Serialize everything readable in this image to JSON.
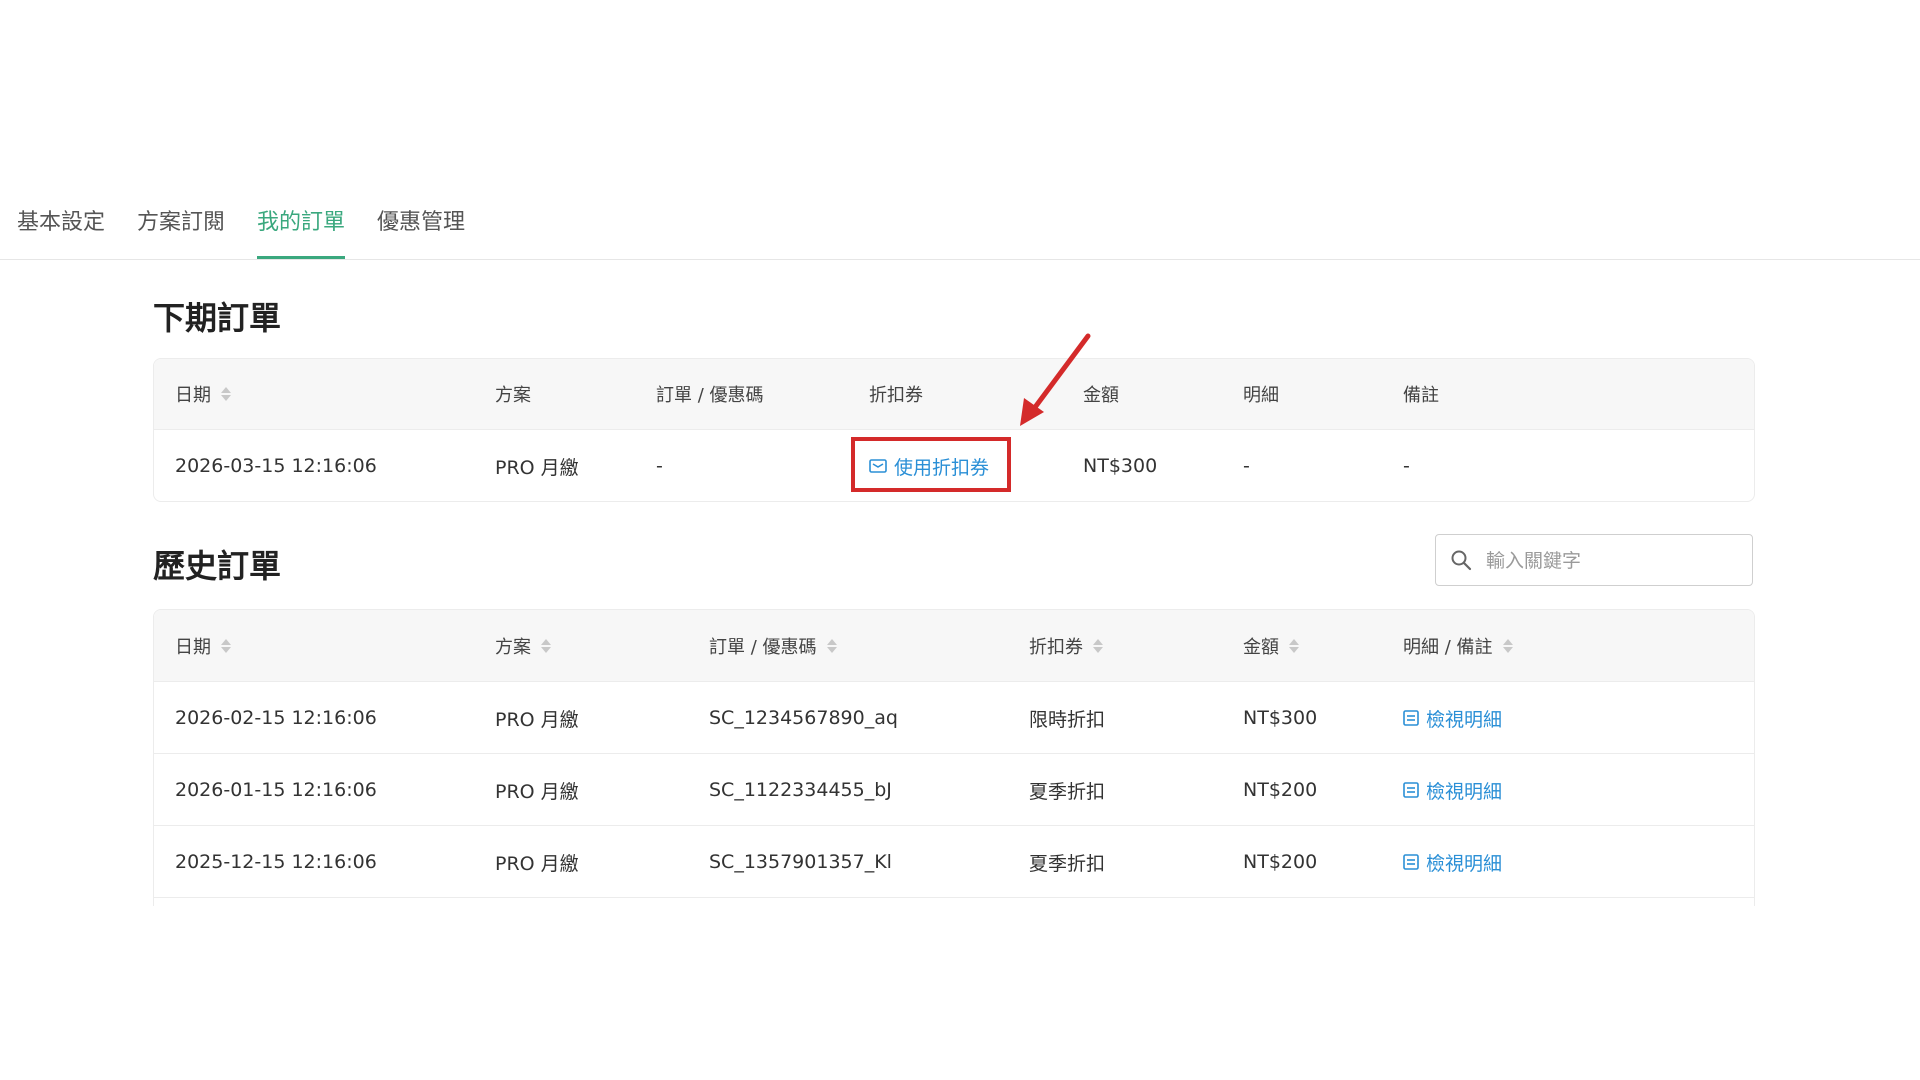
{
  "tabs": [
    {
      "label": "基本設定",
      "active": false
    },
    {
      "label": "方案訂閱",
      "active": false
    },
    {
      "label": "我的訂單",
      "active": true
    },
    {
      "label": "優惠管理",
      "active": false
    }
  ],
  "colors": {
    "accent": "#3aa87e",
    "link": "#2a8fd6",
    "highlight": "#d42a2a"
  },
  "upcoming": {
    "title": "下期訂單",
    "headers": [
      "日期",
      "方案",
      "訂單 / 優惠碼",
      "折扣券",
      "金額",
      "明細",
      "備註"
    ],
    "row": {
      "date": "2026-03-15 12:16:06",
      "plan": "PRO 月繳",
      "order_code": "-",
      "coupon_action": "使用折扣券",
      "coupon_icon": "ticket-icon",
      "amount": "NT$300",
      "detail": "-",
      "note": "-"
    }
  },
  "history": {
    "title": "歷史訂單",
    "search_placeholder": "輸入關鍵字",
    "headers": [
      "日期",
      "方案",
      "訂單 / 優惠碼",
      "折扣券",
      "金額",
      "明細 / 備註"
    ],
    "rows": [
      {
        "date": "2026-02-15 12:16:06",
        "plan": "PRO 月繳",
        "order_code": "SC_1234567890_aq",
        "coupon": "限時折扣",
        "amount": "NT$300",
        "detail": "檢視明細"
      },
      {
        "date": "2026-01-15 12:16:06",
        "plan": "PRO 月繳",
        "order_code": "SC_1122334455_bJ",
        "coupon": "夏季折扣",
        "amount": "NT$200",
        "detail": "檢視明細"
      },
      {
        "date": "2025-12-15 12:16:06",
        "plan": "PRO 月繳",
        "order_code": "SC_1357901357_Kl",
        "coupon": "夏季折扣",
        "amount": "NT$200",
        "detail": "檢視明細"
      }
    ]
  }
}
